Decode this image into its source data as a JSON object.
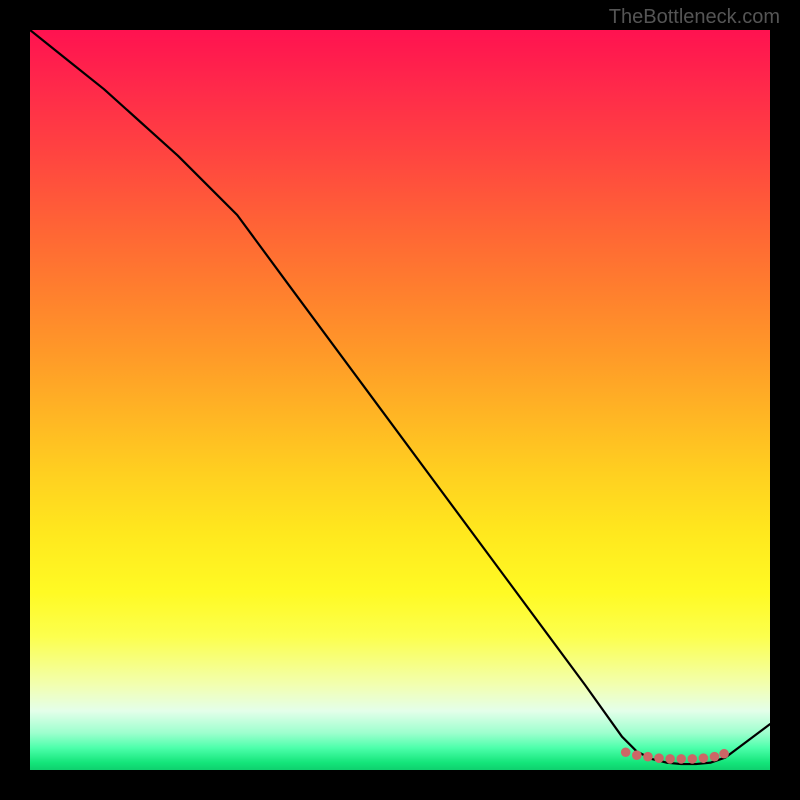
{
  "watermark": "TheBottleneck.com",
  "chart_data": {
    "type": "line",
    "title": "",
    "xlabel": "",
    "ylabel": "",
    "xlim": [
      0,
      100
    ],
    "ylim": [
      0,
      100
    ],
    "series": [
      {
        "name": "curve",
        "x": [
          0,
          5,
          10,
          15,
          20,
          25,
          28,
          35,
          45,
          55,
          65,
          75,
          80,
          82,
          84,
          86,
          88,
          90,
          92,
          94,
          100
        ],
        "y": [
          100,
          96,
          92,
          87.5,
          83,
          78,
          75,
          65.5,
          52,
          38.5,
          25,
          11.5,
          4.5,
          2.5,
          1.5,
          1.0,
          0.8,
          0.8,
          1.0,
          1.7,
          6.2
        ],
        "color": "#000000"
      },
      {
        "name": "markers",
        "x": [
          80.5,
          82,
          83.5,
          85,
          86.5,
          88,
          89.5,
          91,
          92.5,
          93.8
        ],
        "y": [
          2.4,
          2.0,
          1.8,
          1.6,
          1.5,
          1.5,
          1.5,
          1.6,
          1.8,
          2.2
        ],
        "color": "#cc6666",
        "marker": "circle"
      }
    ],
    "gradient_stops": [
      {
        "pos": 0.0,
        "color": "#ff1250"
      },
      {
        "pos": 0.08,
        "color": "#ff2a4a"
      },
      {
        "pos": 0.17,
        "color": "#ff4540"
      },
      {
        "pos": 0.26,
        "color": "#ff6236"
      },
      {
        "pos": 0.35,
        "color": "#ff7e2e"
      },
      {
        "pos": 0.44,
        "color": "#ff9a28"
      },
      {
        "pos": 0.52,
        "color": "#ffb524"
      },
      {
        "pos": 0.6,
        "color": "#ffd020"
      },
      {
        "pos": 0.68,
        "color": "#ffe81e"
      },
      {
        "pos": 0.76,
        "color": "#fffa24"
      },
      {
        "pos": 0.82,
        "color": "#fcff4e"
      },
      {
        "pos": 0.885,
        "color": "#f2ffb0"
      },
      {
        "pos": 0.92,
        "color": "#e4ffea"
      },
      {
        "pos": 0.95,
        "color": "#9dffce"
      },
      {
        "pos": 0.97,
        "color": "#4dffab"
      },
      {
        "pos": 0.99,
        "color": "#14e57a"
      },
      {
        "pos": 1.0,
        "color": "#0fd06e"
      }
    ]
  }
}
